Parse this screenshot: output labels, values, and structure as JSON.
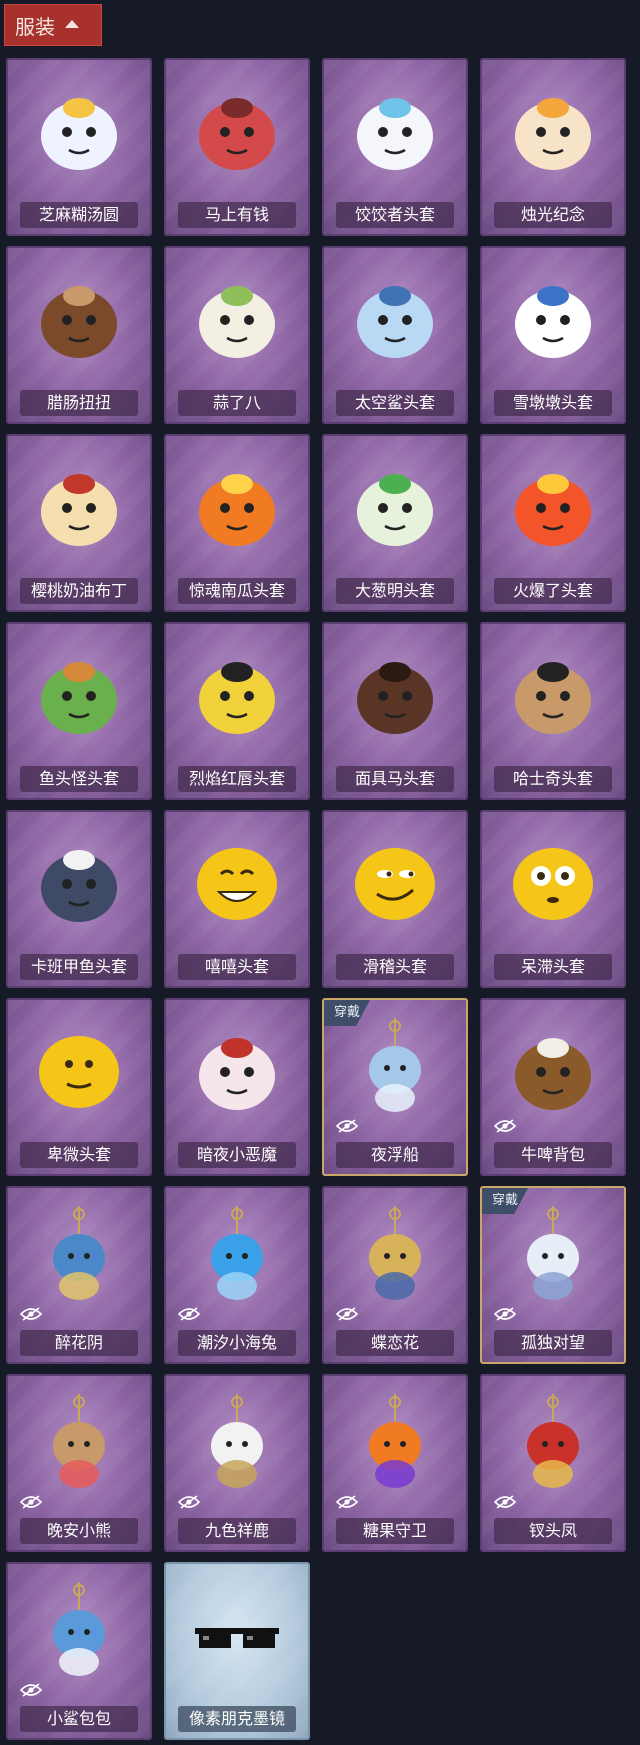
{
  "header": {
    "label": "服装"
  },
  "worn_label": "穿戴",
  "items": [
    {
      "name": "芝麻糊汤圆",
      "art": "tangyuan",
      "worn": false,
      "hidden": false
    },
    {
      "name": "马上有钱",
      "art": "horse-red",
      "worn": false,
      "hidden": false
    },
    {
      "name": "饺饺者头套",
      "art": "dumpling",
      "worn": false,
      "hidden": false
    },
    {
      "name": "烛光纪念",
      "art": "candle",
      "worn": false,
      "hidden": false
    },
    {
      "name": "腊肠扭扭",
      "art": "dog-brown",
      "worn": false,
      "hidden": false
    },
    {
      "name": "蒜了八",
      "art": "garlic",
      "worn": false,
      "hidden": false
    },
    {
      "name": "太空鲨头套",
      "art": "shark-helmet",
      "worn": false,
      "hidden": false
    },
    {
      "name": "雪墩墩头套",
      "art": "snowman",
      "worn": false,
      "hidden": false
    },
    {
      "name": "樱桃奶油布丁",
      "art": "pudding",
      "worn": false,
      "hidden": false
    },
    {
      "name": "惊魂南瓜头套",
      "art": "pumpkin",
      "worn": false,
      "hidden": false
    },
    {
      "name": "大葱明头套",
      "art": "leek",
      "worn": false,
      "hidden": false
    },
    {
      "name": "火爆了头套",
      "art": "fireball",
      "worn": false,
      "hidden": false
    },
    {
      "name": "鱼头怪头套",
      "art": "fish-mask",
      "worn": false,
      "hidden": false
    },
    {
      "name": "烈焰红唇头套",
      "art": "yellow-mask",
      "worn": false,
      "hidden": false
    },
    {
      "name": "面具马头套",
      "art": "horse-mask",
      "worn": false,
      "hidden": false
    },
    {
      "name": "哈士奇头套",
      "art": "husky",
      "worn": false,
      "hidden": false
    },
    {
      "name": "卡班甲鱼头套",
      "art": "whale",
      "worn": false,
      "hidden": false
    },
    {
      "name": "嘻嘻头套",
      "art": "emoji-grin",
      "worn": false,
      "hidden": false
    },
    {
      "name": "滑稽头套",
      "art": "emoji-smirk",
      "worn": false,
      "hidden": false
    },
    {
      "name": "呆滞头套",
      "art": "emoji-stare",
      "worn": false,
      "hidden": false
    },
    {
      "name": "卑微头套",
      "art": "emoji-humble",
      "worn": false,
      "hidden": false
    },
    {
      "name": "暗夜小恶魔",
      "art": "devil",
      "worn": false,
      "hidden": false
    },
    {
      "name": "夜浮船",
      "art": "jellyfish",
      "worn": true,
      "hidden": true
    },
    {
      "name": "牛啤背包",
      "art": "beer",
      "worn": false,
      "hidden": true
    },
    {
      "name": "醉花阴",
      "art": "pendant-blue",
      "worn": false,
      "hidden": true
    },
    {
      "name": "潮汐小海兔",
      "art": "sea-bunny",
      "worn": false,
      "hidden": true
    },
    {
      "name": "蝶恋花",
      "art": "pendant-gold",
      "worn": false,
      "hidden": true
    },
    {
      "name": "孤独对望",
      "art": "doll",
      "worn": true,
      "hidden": true
    },
    {
      "name": "晚安小熊",
      "art": "bear",
      "worn": false,
      "hidden": true
    },
    {
      "name": "九色祥鹿",
      "art": "deer",
      "worn": false,
      "hidden": true
    },
    {
      "name": "糖果守卫",
      "art": "candy-guard",
      "worn": false,
      "hidden": true
    },
    {
      "name": "钗头凤",
      "art": "phoenix-doll",
      "worn": false,
      "hidden": true
    },
    {
      "name": "小鲨包包",
      "art": "shark-bag",
      "worn": false,
      "hidden": true
    },
    {
      "name": "像素朋克墨镜",
      "art": "pixel-glasses",
      "worn": false,
      "hidden": false,
      "light": true
    }
  ],
  "colors": {
    "accent": "#a8312e",
    "background": "#161a26",
    "card": "#8c64a3",
    "worn_border": "#c9a66a"
  }
}
